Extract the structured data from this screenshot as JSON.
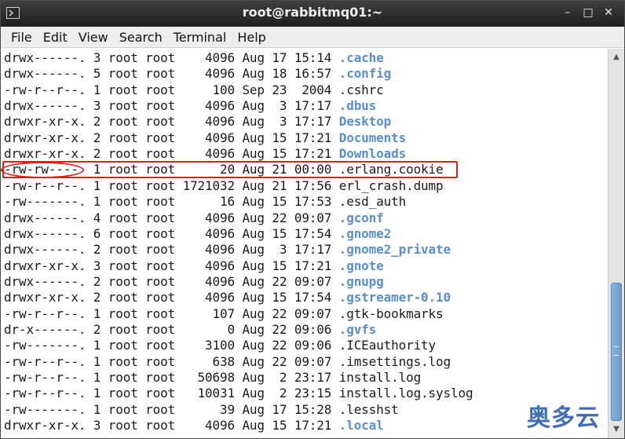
{
  "window": {
    "title": "root@rabbitmq01:~",
    "controls": [
      "–",
      "□",
      "✕"
    ]
  },
  "menu": [
    "File",
    "Edit",
    "View",
    "Search",
    "Terminal",
    "Help"
  ],
  "listing": [
    {
      "prefix": "drwx------. 3 root root    4096 Aug 17 15:14 ",
      "name": ".cache",
      "dir": true
    },
    {
      "prefix": "drwx------. 5 root root    4096 Aug 18 16:57 ",
      "name": ".config",
      "dir": true
    },
    {
      "prefix": "-rw-r--r--. 1 root root     100 Sep 23  2004 ",
      "name": ".cshrc",
      "dir": false
    },
    {
      "prefix": "drwx------. 3 root root    4096 Aug  3 17:17 ",
      "name": ".dbus",
      "dir": true
    },
    {
      "prefix": "drwxr-xr-x. 2 root root    4096 Aug  3 17:17 ",
      "name": "Desktop",
      "dir": true
    },
    {
      "prefix": "drwxr-xr-x. 2 root root    4096 Aug 15 17:21 ",
      "name": "Documents",
      "dir": true
    },
    {
      "prefix": "drwxr-xr-x. 2 root root    4096 Aug 15 17:21 ",
      "name": "Downloads",
      "dir": true
    },
    {
      "prefix": "-rw-rw----  1 root root      20 Aug 21 00:00 ",
      "name": ".erlang.cookie",
      "dir": false
    },
    {
      "prefix": "-rw-r--r--. 1 root root 1721032 Aug 21 17:56 ",
      "name": "erl_crash.dump",
      "dir": false
    },
    {
      "prefix": "-rw-------. 1 root root      16 Aug 15 17:53 ",
      "name": ".esd_auth",
      "dir": false
    },
    {
      "prefix": "drwx------. 4 root root    4096 Aug 22 09:07 ",
      "name": ".gconf",
      "dir": true
    },
    {
      "prefix": "drwx------. 6 root root    4096 Aug 15 17:54 ",
      "name": ".gnome2",
      "dir": true
    },
    {
      "prefix": "drwx------. 2 root root    4096 Aug  3 17:17 ",
      "name": ".gnome2_private",
      "dir": true
    },
    {
      "prefix": "drwxr-xr-x. 3 root root    4096 Aug 15 17:21 ",
      "name": ".gnote",
      "dir": true
    },
    {
      "prefix": "drwx------. 2 root root    4096 Aug 22 09:07 ",
      "name": ".gnupg",
      "dir": true
    },
    {
      "prefix": "drwxr-xr-x. 2 root root    4096 Aug 15 17:54 ",
      "name": ".gstreamer-0.10",
      "dir": true
    },
    {
      "prefix": "-rw-r--r--. 1 root root     107 Aug 22 09:07 ",
      "name": ".gtk-bookmarks",
      "dir": false
    },
    {
      "prefix": "dr-x------. 2 root root       0 Aug 22 09:06 ",
      "name": ".gvfs",
      "dir": true
    },
    {
      "prefix": "-rw-------. 1 root root    3100 Aug 22 09:06 ",
      "name": ".ICEauthority",
      "dir": false
    },
    {
      "prefix": "-rw-r--r--. 1 root root     638 Aug 22 09:07 ",
      "name": ".imsettings.log",
      "dir": false
    },
    {
      "prefix": "-rw-r--r--. 1 root root   50698 Aug  2 23:17 ",
      "name": "install.log",
      "dir": false
    },
    {
      "prefix": "-rw-r--r--. 1 root root   10031 Aug  2 23:15 ",
      "name": "install.log.syslog",
      "dir": false
    },
    {
      "prefix": "-rw-------. 1 root root      39 Aug 17 15:28 ",
      "name": ".lesshst",
      "dir": false
    },
    {
      "prefix": "drwxr-xr-x. 3 root root    4096 Aug 15 17:21 ",
      "name": ".local",
      "dir": true
    }
  ],
  "colors": {
    "directory": "#5b8ec7",
    "highlight": "#d62020",
    "titlebar": "#2e2e2e"
  },
  "watermark": "奥多云"
}
